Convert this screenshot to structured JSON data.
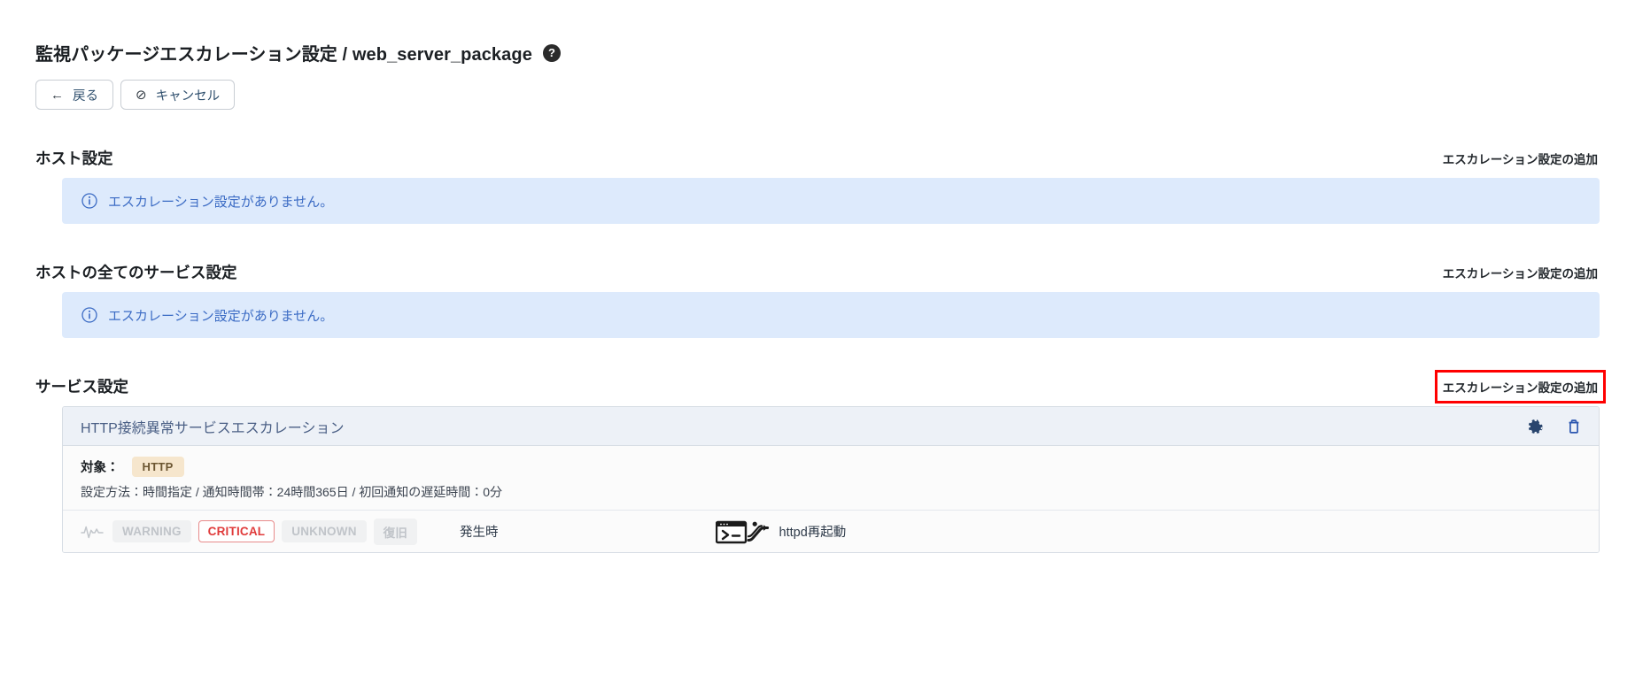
{
  "header": {
    "title": "監視パッケージエスカレーション設定 / web_server_package",
    "help_icon_label": "?"
  },
  "toolbar": {
    "back_label": "戻る",
    "back_glyph": "←",
    "cancel_label": "キャンセル",
    "cancel_glyph": "⊘"
  },
  "sections": [
    {
      "title": "ホスト設定",
      "add_link": "エスカレーション設定の追加",
      "empty_message": "エスカレーション設定がありません。"
    },
    {
      "title": "ホストの全てのサービス設定",
      "add_link": "エスカレーション設定の追加",
      "empty_message": "エスカレーション設定がありません。"
    },
    {
      "title": "サービス設定",
      "add_link": "エスカレーション設定の追加"
    }
  ],
  "escalation_card": {
    "name": "HTTP接続異常サービスエスカレーション",
    "settings_icon": "gear-icon",
    "delete_icon": "trash-icon",
    "target_label": "対象：",
    "target_badge": "HTTP",
    "meta": "設定方法：時間指定 / 通知時間帯：24時間365日 / 初回通知の遅延時間：0分",
    "statuses": [
      {
        "label": "WARNING",
        "active": false
      },
      {
        "label": "CRITICAL",
        "active": true
      },
      {
        "label": "UNKNOWN",
        "active": false
      },
      {
        "label": "復旧",
        "active": false
      }
    ],
    "timing": "発生時",
    "action_label": "httpd再起動"
  },
  "colors": {
    "alert_bg": "#ddeafc",
    "alert_text": "#3b6bc4",
    "card_header_bg": "#edf1f7",
    "badge_bg": "#f6e6cd",
    "critical": "#e03b3b",
    "highlight_border": "#ff0000"
  }
}
